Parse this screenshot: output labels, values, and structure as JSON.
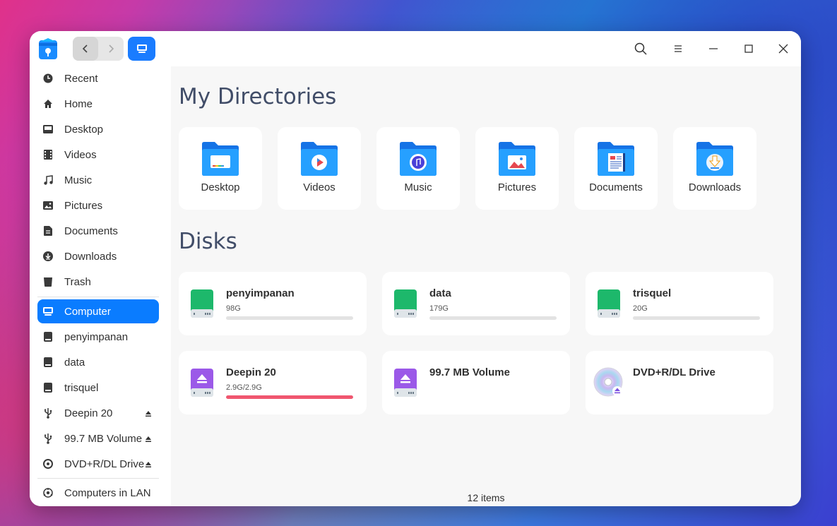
{
  "window": {
    "status_text": "12 items"
  },
  "sidebar": {
    "quick": [
      {
        "label": "Recent",
        "icon": "clock-icon"
      },
      {
        "label": "Home",
        "icon": "home-icon"
      },
      {
        "label": "Desktop",
        "icon": "desktop-icon"
      },
      {
        "label": "Videos",
        "icon": "film-icon"
      },
      {
        "label": "Music",
        "icon": "music-note-icon"
      },
      {
        "label": "Pictures",
        "icon": "image-icon"
      },
      {
        "label": "Documents",
        "icon": "document-icon"
      },
      {
        "label": "Downloads",
        "icon": "download-icon"
      },
      {
        "label": "Trash",
        "icon": "trash-icon"
      }
    ],
    "devices": [
      {
        "label": "Computer",
        "icon": "computer-icon",
        "active": true
      },
      {
        "label": "penyimpanan",
        "icon": "disk-icon"
      },
      {
        "label": "data",
        "icon": "disk-icon"
      },
      {
        "label": "trisquel",
        "icon": "disk-icon"
      },
      {
        "label": "Deepin 20",
        "icon": "usb-icon",
        "eject": true
      },
      {
        "label": "99.7 MB Volume",
        "icon": "usb-icon",
        "eject": true
      },
      {
        "label": "DVD+R/DL Drive",
        "icon": "optical-disc-icon",
        "eject": true
      }
    ],
    "network": [
      {
        "label": "Computers in LAN",
        "icon": "network-icon"
      }
    ]
  },
  "main": {
    "directories_title": "My Directories",
    "directories": [
      {
        "label": "Desktop",
        "icon": "desktop-folder-icon"
      },
      {
        "label": "Videos",
        "icon": "videos-folder-icon"
      },
      {
        "label": "Music",
        "icon": "music-folder-icon"
      },
      {
        "label": "Pictures",
        "icon": "pictures-folder-icon"
      },
      {
        "label": "Documents",
        "icon": "documents-folder-icon"
      },
      {
        "label": "Downloads",
        "icon": "downloads-folder-icon"
      }
    ],
    "disks_title": "Disks",
    "disks": [
      {
        "name": "penyimpanan",
        "size": "98G",
        "usage_fraction": 0.0,
        "type": "internal-disk",
        "color": "#1db86b"
      },
      {
        "name": "data",
        "size": "179G",
        "usage_fraction": 0.0,
        "type": "internal-disk",
        "color": "#1db86b"
      },
      {
        "name": "trisquel",
        "size": "20G",
        "usage_fraction": 0.0,
        "type": "internal-disk",
        "color": "#1db86b"
      },
      {
        "name": "Deepin 20",
        "size": "2.9G/2.9G",
        "usage_fraction": 1.0,
        "type": "removable-disk",
        "color": "#9b59e8",
        "bar_color": "#f0566f"
      },
      {
        "name": "99.7 MB Volume",
        "size": "",
        "type": "removable-disk",
        "color": "#9b59e8"
      },
      {
        "name": "DVD+R/DL Drive",
        "size": "",
        "type": "optical-drive"
      }
    ]
  },
  "colors": {
    "accent": "#0a7cff",
    "title_text": "#414d68"
  }
}
